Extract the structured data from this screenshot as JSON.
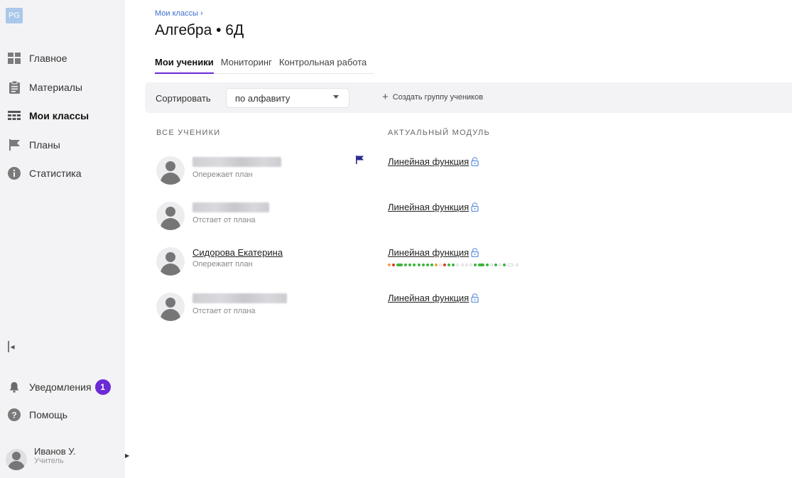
{
  "logo": "PG",
  "sidebar": {
    "items": [
      {
        "label": "Главное",
        "icon": "dashboard-icon"
      },
      {
        "label": "Материалы",
        "icon": "clipboard-icon"
      },
      {
        "label": "Мои классы",
        "icon": "classes-icon",
        "active": true
      },
      {
        "label": "Планы",
        "icon": "flag-icon"
      },
      {
        "label": "Статистика",
        "icon": "info-icon"
      }
    ],
    "notifications": {
      "label": "Уведомления",
      "count": "1"
    },
    "help": {
      "label": "Помощь"
    },
    "user": {
      "name": "Иванов У.",
      "role": "Учитель"
    }
  },
  "breadcrumb": "Мои классы ›",
  "page_title": "Алгебра • 6Д",
  "tabs": [
    {
      "label": "Мои ученики",
      "active": true
    },
    {
      "label": "Мониторинг"
    },
    {
      "label": "Контрольная работа"
    }
  ],
  "toolbar": {
    "sort_label": "Сортировать",
    "sort_value": "по алфавиту",
    "create_group": "Создать группу учеников"
  },
  "columns": {
    "students": "ВСЕ УЧЕНИКИ",
    "module": "АКТУАЛЬНЫЙ МОДУЛЬ"
  },
  "students": [
    {
      "name": "",
      "name_hidden": true,
      "status": "Опережает план",
      "flag": true,
      "module": "Линейная функция"
    },
    {
      "name": "",
      "name_hidden": true,
      "status": "Отстает от плана",
      "flag": false,
      "module": "Линейная функция"
    },
    {
      "name": "Сидорова Екатерина",
      "name_hidden": false,
      "status": "Опережает план",
      "flag": false,
      "module": "Линейная функция",
      "progress": [
        "orange",
        "red",
        "green-wide",
        "green",
        "green",
        "green",
        "green",
        "green",
        "green",
        "green",
        "orange",
        "empty",
        "red",
        "green",
        "green",
        "empty",
        "empty",
        "empty",
        "empty",
        "green",
        "green-wide",
        "green",
        "empty",
        "green",
        "empty",
        "green",
        "empty-wide",
        "empty"
      ]
    },
    {
      "name": "",
      "name_hidden": true,
      "status": "Отстает от плана",
      "flag": false,
      "module": "Линейная функция"
    }
  ],
  "colors": {
    "accent": "#6b2ad6",
    "link": "#3a6fd0",
    "flag": "#2b2c8f",
    "lock": "#5b8fe0",
    "progress_green": "#3cb53c",
    "progress_red": "#e0363a",
    "progress_orange": "#f2a23a"
  }
}
